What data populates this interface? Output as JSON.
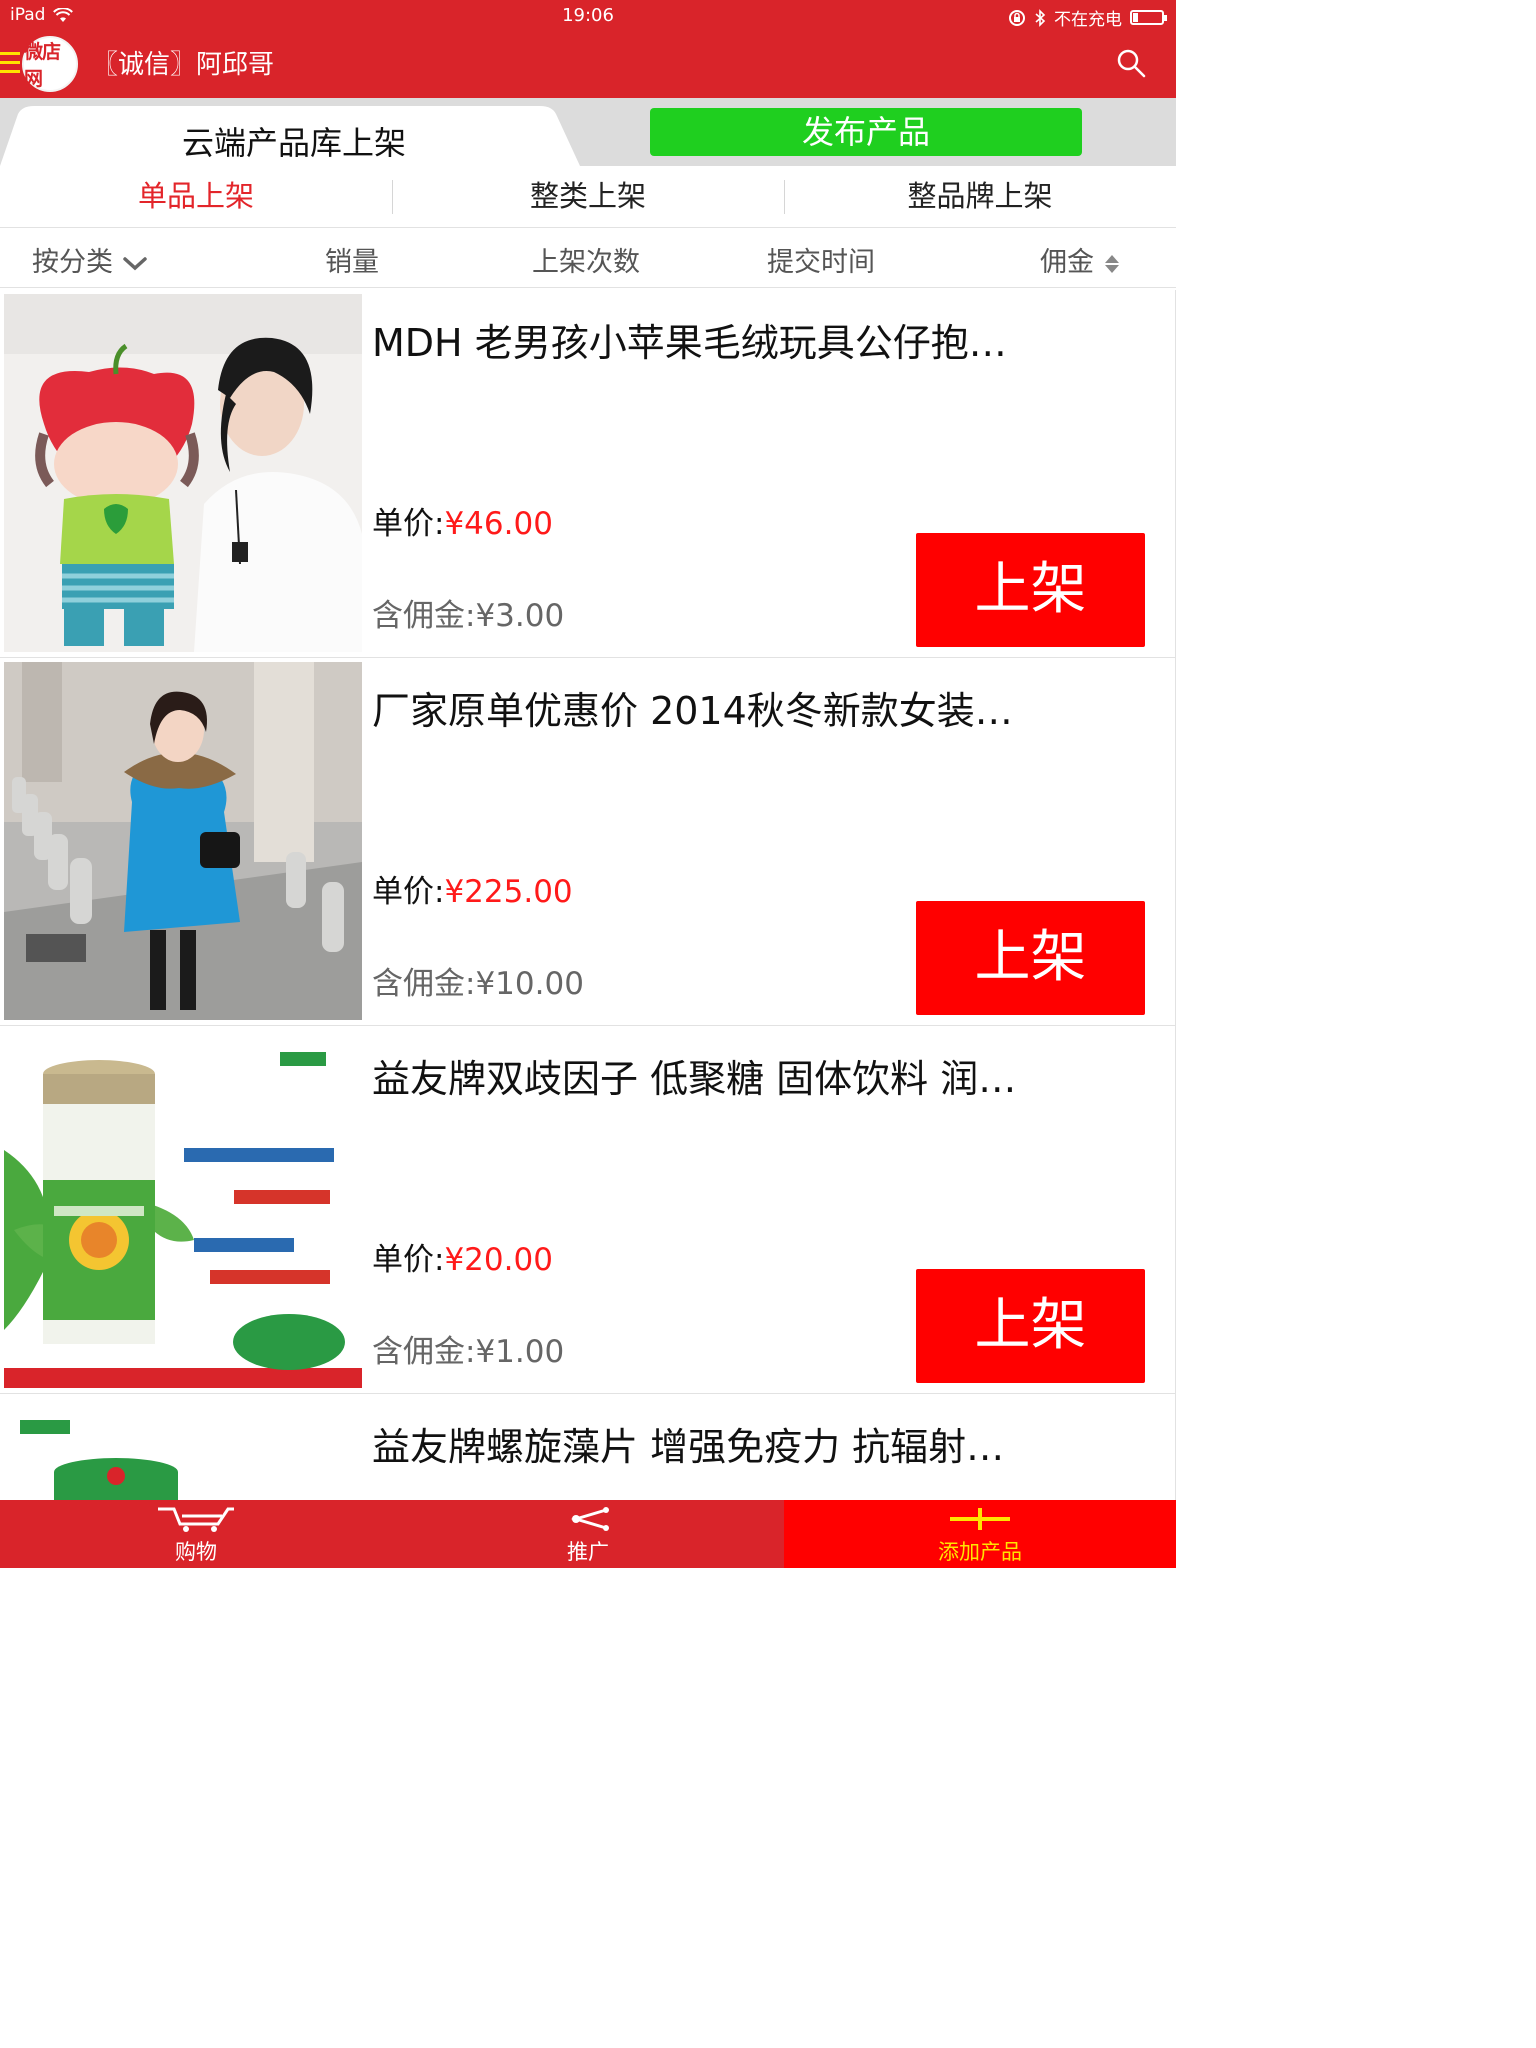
{
  "status_bar": {
    "device": "iPad",
    "time": "19:06",
    "charging": "不在充电"
  },
  "header": {
    "logo_text": "微店网",
    "shop_name": "〖诚信〗阿邱哥"
  },
  "top_tabs": {
    "cloud_label": "云端产品库上架",
    "publish_label": "发布产品"
  },
  "sub_tabs": [
    {
      "label": "单品上架",
      "active": true
    },
    {
      "label": "整类上架",
      "active": false
    },
    {
      "label": "整品牌上架",
      "active": false
    }
  ],
  "sort_bar": {
    "category": "按分类",
    "sales": "销量",
    "listings": "上架次数",
    "submit_time": "提交时间",
    "commission": "佣金"
  },
  "products": [
    {
      "title": "MDH 老男孩小苹果毛绒玩具公仔抱…",
      "price_label": "单价:",
      "price": "¥46.00",
      "commission_label": "含佣金:",
      "commission": "¥3.00",
      "button": "上架"
    },
    {
      "title": "厂家原单优惠价 2014秋冬新款女装…",
      "price_label": "单价:",
      "price": "¥225.00",
      "commission_label": "含佣金:",
      "commission": "¥10.00",
      "button": "上架"
    },
    {
      "title": "益友牌双歧因子 低聚糖 固体饮料 润…",
      "price_label": "单价:",
      "price": "¥20.00",
      "commission_label": "含佣金:",
      "commission": "¥1.00",
      "button": "上架"
    },
    {
      "title": "益友牌螺旋藻片 增强免疫力 抗辐射…"
    }
  ],
  "bottom_nav": [
    {
      "label": "购物",
      "icon": "cart-icon",
      "active": false
    },
    {
      "label": "推广",
      "icon": "share-icon",
      "active": false
    },
    {
      "label": "添加产品",
      "icon": "plus-icon",
      "active": true
    }
  ],
  "colors": {
    "brand_red": "#d9242a",
    "button_red": "#ff0000",
    "publish_green": "#1fcf1f",
    "price_red": "#ff1a1a",
    "active_nav_text": "#ffe400"
  }
}
